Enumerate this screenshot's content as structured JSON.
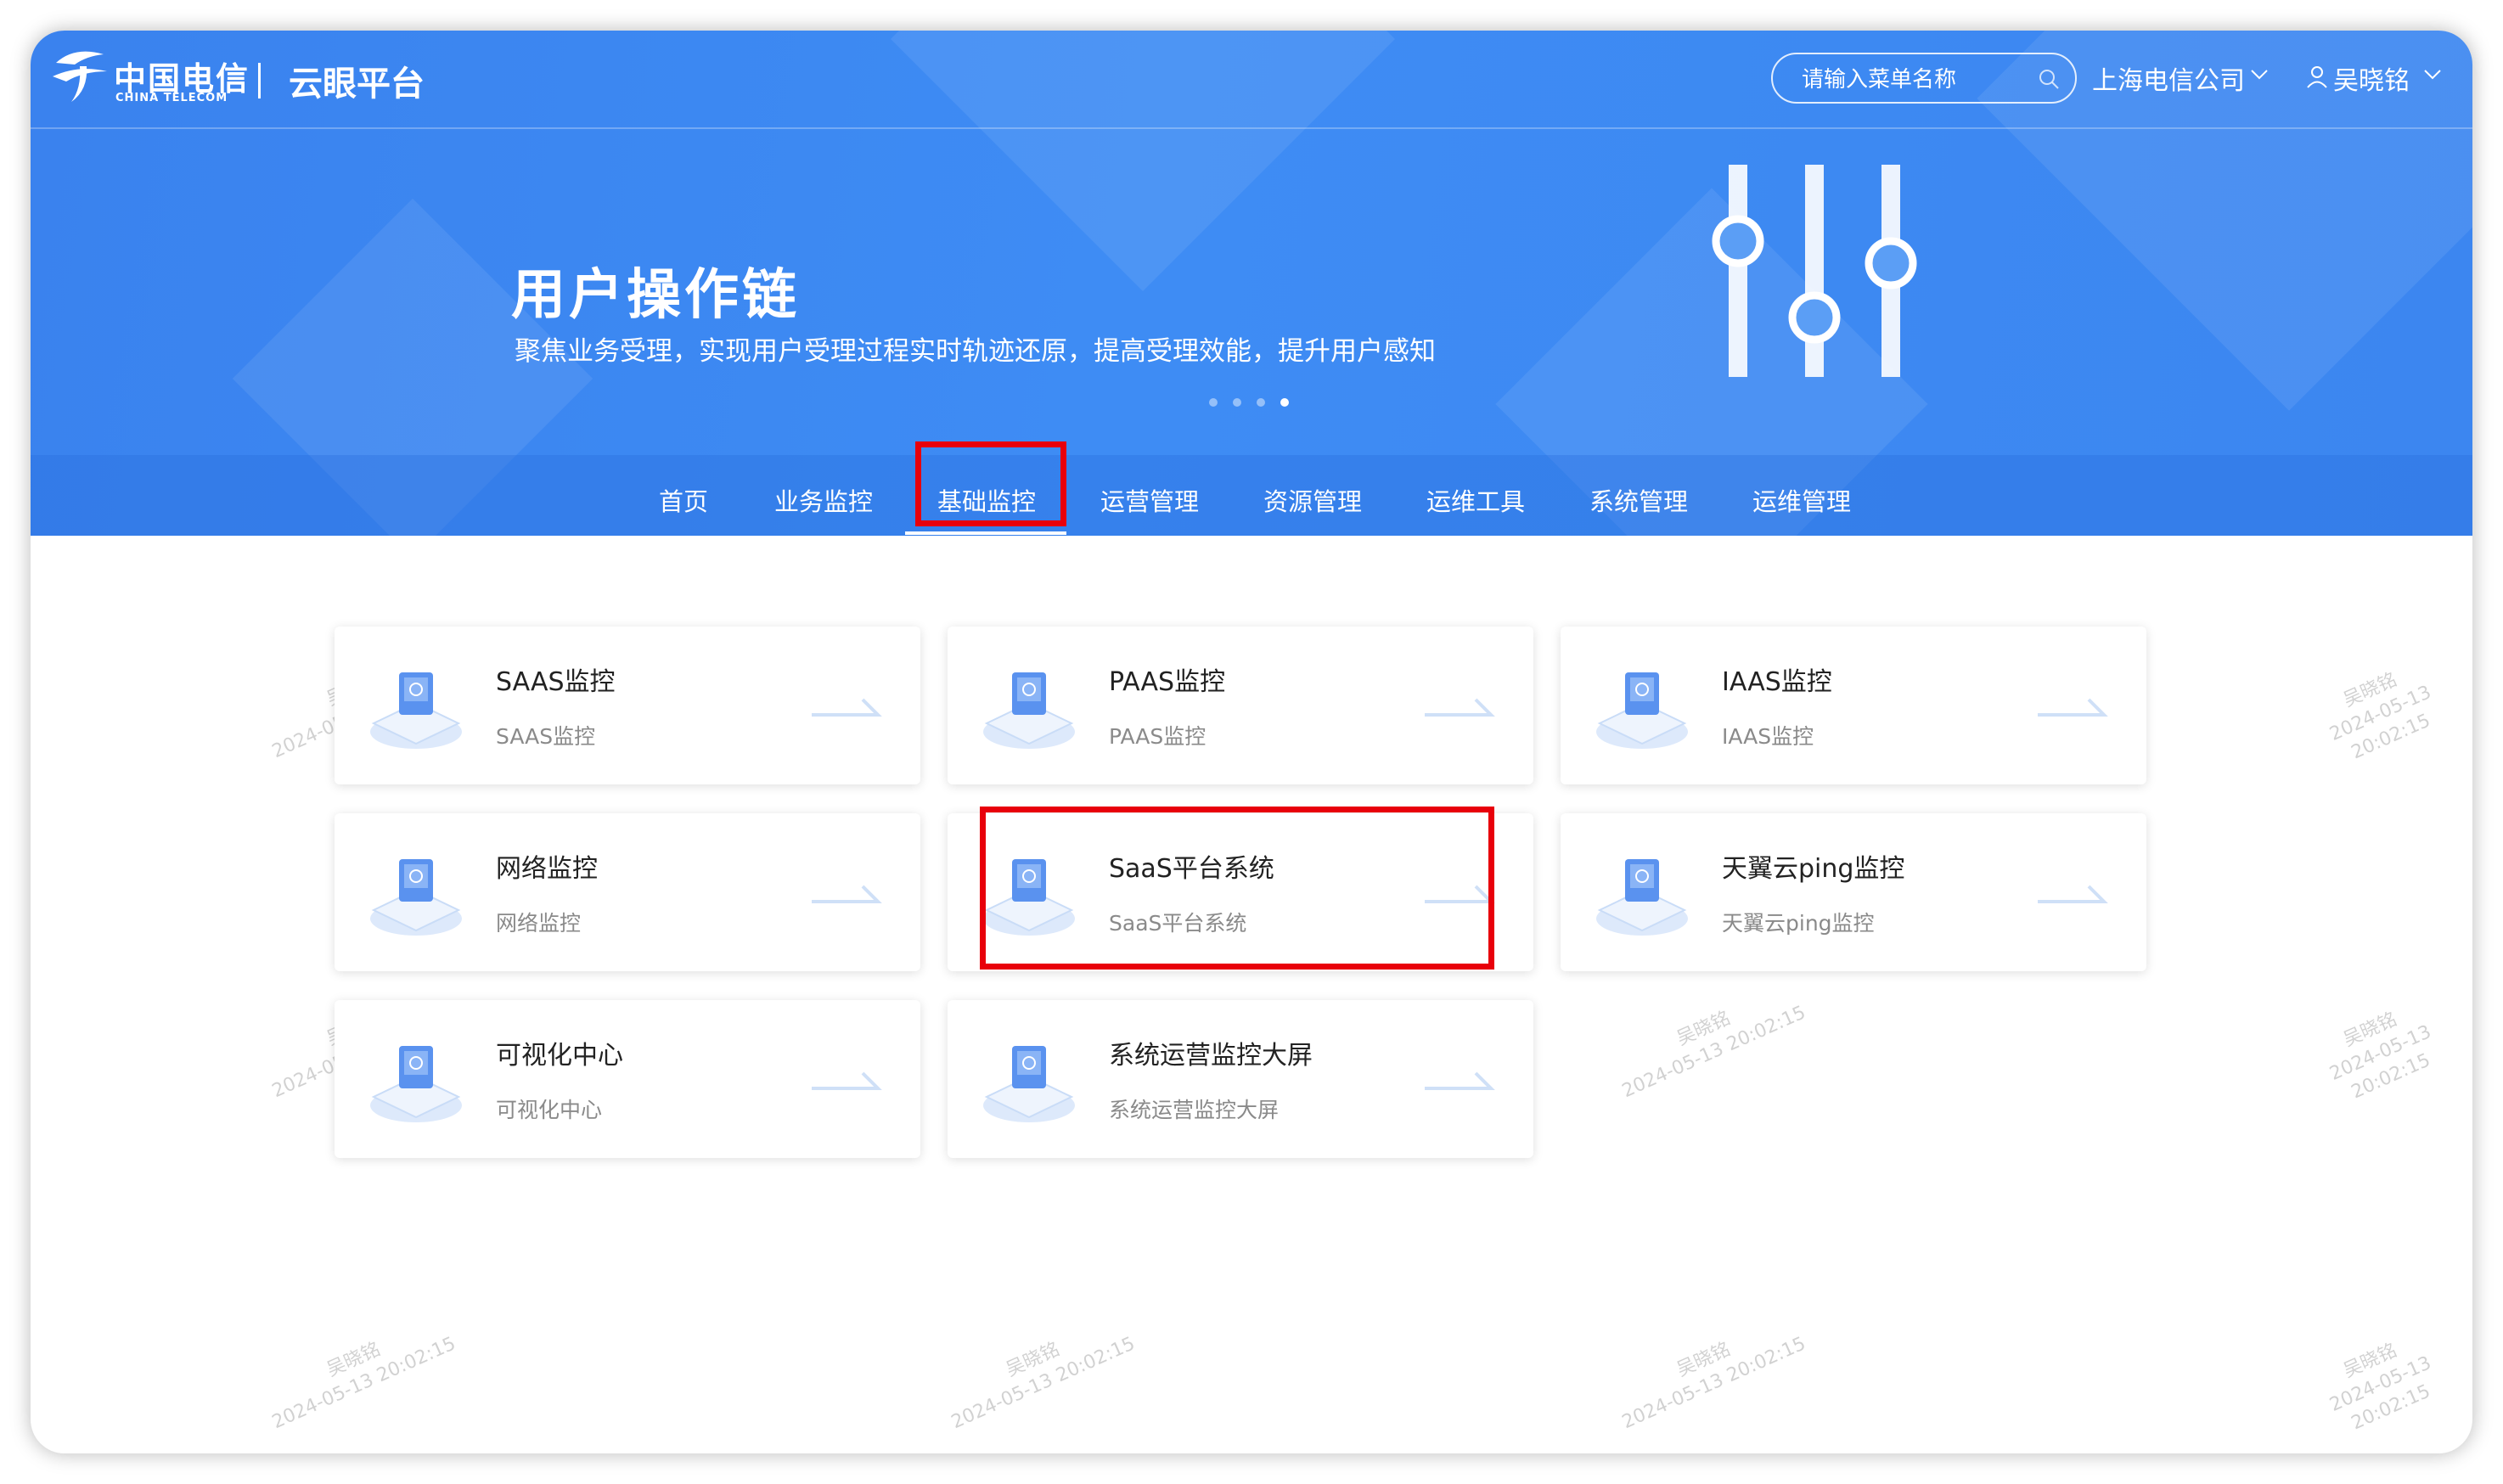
{
  "header": {
    "logo_cn": "中国电信",
    "logo_en": "CHINA TELECOM",
    "platform_name": "云眼平台",
    "search_placeholder": "请输入菜单名称",
    "company": "上海电信公司",
    "user": "吴晓铭"
  },
  "banner": {
    "title": "用户操作链",
    "subtitle": "聚焦业务受理，实现用户受理过程实时轨迹还原，提高受理效能，提升用户感知",
    "slides_total": 4,
    "active_slide": 4
  },
  "nav": {
    "items": [
      "首页",
      "业务监控",
      "基础监控",
      "运营管理",
      "资源管理",
      "运维工具",
      "系统管理",
      "运维管理"
    ],
    "active": "基础监控"
  },
  "cards": [
    {
      "title": "SAAS监控",
      "subtitle": "SAAS监控"
    },
    {
      "title": "PAAS监控",
      "subtitle": "PAAS监控"
    },
    {
      "title": "IAAS监控",
      "subtitle": "IAAS监控"
    },
    {
      "title": "网络监控",
      "subtitle": "网络监控"
    },
    {
      "title": "SaaS平台系统",
      "subtitle": "SaaS平台系统"
    },
    {
      "title": "天翼云ping监控",
      "subtitle": "天翼云ping监控"
    },
    {
      "title": "可视化中心",
      "subtitle": "可视化中心"
    },
    {
      "title": "系统运营监控大屏",
      "subtitle": "系统运营监控大屏"
    }
  ],
  "watermark": {
    "name": "吴晓铭",
    "time": "2024-05-13 20:02:15"
  },
  "colors": {
    "brand_blue": "#3e8cf4",
    "highlight": "#e8000b",
    "card_title": "#222222",
    "card_sub": "#8a8a8a"
  }
}
